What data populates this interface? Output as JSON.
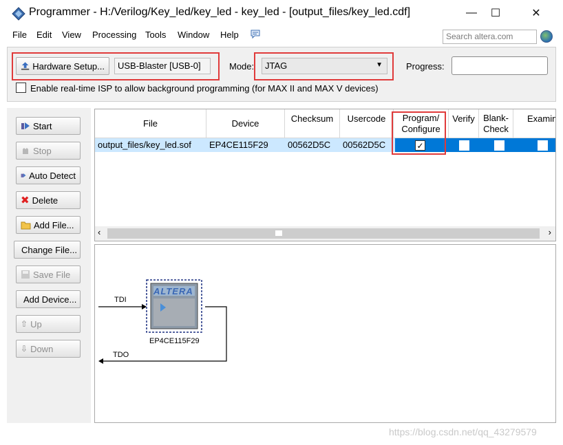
{
  "window": {
    "title": "Programmer - H:/Verilog/Key_led/key_led - key_led - [output_files/key_led.cdf]",
    "controls": {
      "minimize": "—",
      "maximize": "☐",
      "close": "✕"
    }
  },
  "menu": {
    "items": [
      "File",
      "Edit",
      "View",
      "Processing",
      "Tools",
      "Window",
      "Help"
    ],
    "search_placeholder": "Search altera.com"
  },
  "toolbar": {
    "hardware_setup_label": "Hardware Setup...",
    "hardware_value": "USB-Blaster [USB-0]",
    "mode_label": "Mode:",
    "mode_value": "JTAG",
    "progress_label": "Progress:",
    "isp_label": "Enable real-time ISP to allow background programming (for MAX II and MAX V devices)"
  },
  "side_buttons": [
    {
      "label": "Start",
      "enabled": true
    },
    {
      "label": "Stop",
      "enabled": false
    },
    {
      "label": "Auto Detect",
      "enabled": true
    },
    {
      "label": "Delete",
      "enabled": true
    },
    {
      "label": "Add File...",
      "enabled": true
    },
    {
      "label": "Change File...",
      "enabled": true
    },
    {
      "label": "Save File",
      "enabled": false
    },
    {
      "label": "Add Device...",
      "enabled": true
    },
    {
      "label": "Up",
      "enabled": false
    },
    {
      "label": "Down",
      "enabled": false
    }
  ],
  "table": {
    "headers": [
      "File",
      "Device",
      "Checksum",
      "Usercode",
      "Program/ Configure",
      "Verify",
      "Blank- Check",
      "Examin"
    ],
    "rows": [
      {
        "file": "output_files/key_led.sof",
        "device": "EP4CE115F29",
        "checksum": "00562D5C",
        "usercode": "00562D5C",
        "program_configure": true,
        "verify": false,
        "blank_check": false,
        "examine": false
      }
    ]
  },
  "chain": {
    "tdi_label": "TDI",
    "tdo_label": "TDO",
    "device_label": "EP4CE115F29",
    "chip_logo": "ALTERA"
  },
  "watermark": "https://blog.csdn.net/qq_43279579"
}
